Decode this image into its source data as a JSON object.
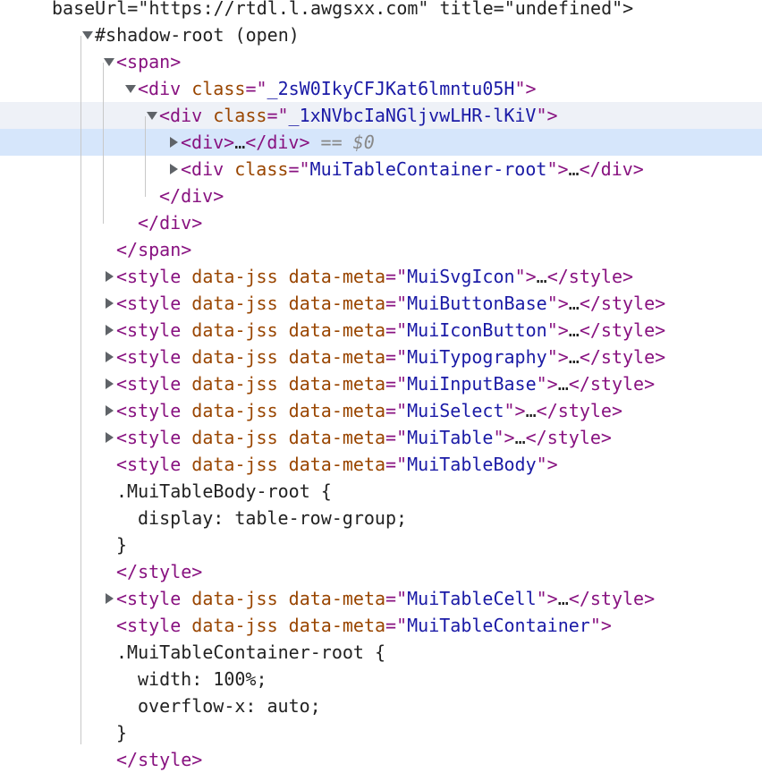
{
  "panel": "Elements",
  "lines": [
    {
      "id": "l0",
      "indent": 2,
      "toggle": "none",
      "state": "",
      "segments": [
        {
          "t": "baseUrl=\"https://rtdl.l.awgsxx.com\" title=\"undefined\">",
          "c": "pl"
        }
      ]
    },
    {
      "id": "l1",
      "indent": 4,
      "toggle": "open",
      "state": "",
      "segments": [
        {
          "t": "#shadow-root (open)",
          "c": "pl"
        }
      ]
    },
    {
      "id": "l2",
      "indent": 5,
      "toggle": "open",
      "state": "",
      "segments": [
        {
          "t": "<span>",
          "c": "tag"
        }
      ]
    },
    {
      "id": "l3",
      "indent": 6,
      "toggle": "open",
      "state": "",
      "segments": [
        {
          "t": "<div ",
          "c": "tag"
        },
        {
          "t": "class",
          "c": "an"
        },
        {
          "t": "=\"",
          "c": "tag"
        },
        {
          "t": "_2sW0IkyCFJKat6lmntu05H",
          "c": "av"
        },
        {
          "t": "\">",
          "c": "tag"
        }
      ]
    },
    {
      "id": "l4",
      "indent": 7,
      "toggle": "open",
      "state": "hover",
      "segments": [
        {
          "t": "<div ",
          "c": "tag"
        },
        {
          "t": "class",
          "c": "an"
        },
        {
          "t": "=\"",
          "c": "tag"
        },
        {
          "t": "_1xNVbcIaNGljvwLHR-lKiV",
          "c": "av"
        },
        {
          "t": "\">",
          "c": "tag"
        }
      ]
    },
    {
      "id": "l5",
      "indent": 8,
      "toggle": "closed",
      "state": "selected",
      "segments": [
        {
          "t": "<div>",
          "c": "tag"
        },
        {
          "t": "…",
          "c": "pl"
        },
        {
          "t": "</div>",
          "c": "tag"
        },
        {
          "t": " == $0",
          "c": "dim"
        }
      ]
    },
    {
      "id": "l6",
      "indent": 8,
      "toggle": "closed",
      "state": "",
      "segments": [
        {
          "t": "<div ",
          "c": "tag"
        },
        {
          "t": "class",
          "c": "an"
        },
        {
          "t": "=\"",
          "c": "tag"
        },
        {
          "t": "MuiTableContainer-root",
          "c": "av"
        },
        {
          "t": "\">",
          "c": "tag"
        },
        {
          "t": "…",
          "c": "pl"
        },
        {
          "t": "</div>",
          "c": "tag"
        }
      ]
    },
    {
      "id": "l7",
      "indent": 7,
      "toggle": "none",
      "state": "",
      "segments": [
        {
          "t": "</div>",
          "c": "tag"
        }
      ]
    },
    {
      "id": "l8",
      "indent": 6,
      "toggle": "none",
      "state": "",
      "segments": [
        {
          "t": "</div>",
          "c": "tag"
        }
      ]
    },
    {
      "id": "l9",
      "indent": 5,
      "toggle": "none",
      "state": "",
      "segments": [
        {
          "t": "</span>",
          "c": "tag"
        }
      ]
    },
    {
      "id": "l10",
      "indent": 5,
      "toggle": "closed",
      "state": "",
      "segments": [
        {
          "t": "<style ",
          "c": "tag"
        },
        {
          "t": "data-jss data-meta",
          "c": "an"
        },
        {
          "t": "=\"",
          "c": "tag"
        },
        {
          "t": "MuiSvgIcon",
          "c": "av"
        },
        {
          "t": "\">",
          "c": "tag"
        },
        {
          "t": "…",
          "c": "pl"
        },
        {
          "t": "</style>",
          "c": "tag"
        }
      ]
    },
    {
      "id": "l11",
      "indent": 5,
      "toggle": "closed",
      "state": "",
      "segments": [
        {
          "t": "<style ",
          "c": "tag"
        },
        {
          "t": "data-jss data-meta",
          "c": "an"
        },
        {
          "t": "=\"",
          "c": "tag"
        },
        {
          "t": "MuiButtonBase",
          "c": "av"
        },
        {
          "t": "\">",
          "c": "tag"
        },
        {
          "t": "…",
          "c": "pl"
        },
        {
          "t": "</style>",
          "c": "tag"
        }
      ]
    },
    {
      "id": "l12",
      "indent": 5,
      "toggle": "closed",
      "state": "",
      "segments": [
        {
          "t": "<style ",
          "c": "tag"
        },
        {
          "t": "data-jss data-meta",
          "c": "an"
        },
        {
          "t": "=\"",
          "c": "tag"
        },
        {
          "t": "MuiIconButton",
          "c": "av"
        },
        {
          "t": "\">",
          "c": "tag"
        },
        {
          "t": "…",
          "c": "pl"
        },
        {
          "t": "</style>",
          "c": "tag"
        }
      ]
    },
    {
      "id": "l13",
      "indent": 5,
      "toggle": "closed",
      "state": "",
      "segments": [
        {
          "t": "<style ",
          "c": "tag"
        },
        {
          "t": "data-jss data-meta",
          "c": "an"
        },
        {
          "t": "=\"",
          "c": "tag"
        },
        {
          "t": "MuiTypography",
          "c": "av"
        },
        {
          "t": "\">",
          "c": "tag"
        },
        {
          "t": "…",
          "c": "pl"
        },
        {
          "t": "</style>",
          "c": "tag"
        }
      ]
    },
    {
      "id": "l14",
      "indent": 5,
      "toggle": "closed",
      "state": "",
      "segments": [
        {
          "t": "<style ",
          "c": "tag"
        },
        {
          "t": "data-jss data-meta",
          "c": "an"
        },
        {
          "t": "=\"",
          "c": "tag"
        },
        {
          "t": "MuiInputBase",
          "c": "av"
        },
        {
          "t": "\">",
          "c": "tag"
        },
        {
          "t": "…",
          "c": "pl"
        },
        {
          "t": "</style>",
          "c": "tag"
        }
      ]
    },
    {
      "id": "l15",
      "indent": 5,
      "toggle": "closed",
      "state": "",
      "segments": [
        {
          "t": "<style ",
          "c": "tag"
        },
        {
          "t": "data-jss data-meta",
          "c": "an"
        },
        {
          "t": "=\"",
          "c": "tag"
        },
        {
          "t": "MuiSelect",
          "c": "av"
        },
        {
          "t": "\">",
          "c": "tag"
        },
        {
          "t": "…",
          "c": "pl"
        },
        {
          "t": "</style>",
          "c": "tag"
        }
      ]
    },
    {
      "id": "l16",
      "indent": 5,
      "toggle": "closed",
      "state": "",
      "segments": [
        {
          "t": "<style ",
          "c": "tag"
        },
        {
          "t": "data-jss data-meta",
          "c": "an"
        },
        {
          "t": "=\"",
          "c": "tag"
        },
        {
          "t": "MuiTable",
          "c": "av"
        },
        {
          "t": "\">",
          "c": "tag"
        },
        {
          "t": "…",
          "c": "pl"
        },
        {
          "t": "</style>",
          "c": "tag"
        }
      ]
    },
    {
      "id": "l17",
      "indent": 5,
      "toggle": "none",
      "state": "",
      "segments": [
        {
          "t": "<style ",
          "c": "tag"
        },
        {
          "t": "data-jss data-meta",
          "c": "an"
        },
        {
          "t": "=\"",
          "c": "tag"
        },
        {
          "t": "MuiTableBody",
          "c": "av"
        },
        {
          "t": "\">",
          "c": "tag"
        }
      ]
    },
    {
      "id": "l18",
      "indent": 5,
      "toggle": "none",
      "state": "",
      "segments": [
        {
          "t": ".MuiTableBody-root {",
          "c": "css"
        }
      ]
    },
    {
      "id": "l19",
      "indent": 6,
      "toggle": "none",
      "state": "",
      "segments": [
        {
          "t": "display: table-row-group;",
          "c": "css"
        }
      ]
    },
    {
      "id": "l20",
      "indent": 5,
      "toggle": "none",
      "state": "",
      "segments": [
        {
          "t": "}",
          "c": "css"
        }
      ]
    },
    {
      "id": "l21",
      "indent": 5,
      "toggle": "none",
      "state": "",
      "segments": [
        {
          "t": "</style>",
          "c": "tag"
        }
      ]
    },
    {
      "id": "l22",
      "indent": 5,
      "toggle": "closed",
      "state": "",
      "segments": [
        {
          "t": "<style ",
          "c": "tag"
        },
        {
          "t": "data-jss data-meta",
          "c": "an"
        },
        {
          "t": "=\"",
          "c": "tag"
        },
        {
          "t": "MuiTableCell",
          "c": "av"
        },
        {
          "t": "\">",
          "c": "tag"
        },
        {
          "t": "…",
          "c": "pl"
        },
        {
          "t": "</style>",
          "c": "tag"
        }
      ]
    },
    {
      "id": "l23",
      "indent": 5,
      "toggle": "none",
      "state": "",
      "segments": [
        {
          "t": "<style ",
          "c": "tag"
        },
        {
          "t": "data-jss data-meta",
          "c": "an"
        },
        {
          "t": "=\"",
          "c": "tag"
        },
        {
          "t": "MuiTableContainer",
          "c": "av"
        },
        {
          "t": "\">",
          "c": "tag"
        }
      ]
    },
    {
      "id": "l24",
      "indent": 5,
      "toggle": "none",
      "state": "",
      "segments": [
        {
          "t": ".MuiTableContainer-root {",
          "c": "css"
        }
      ]
    },
    {
      "id": "l25",
      "indent": 6,
      "toggle": "none",
      "state": "",
      "segments": [
        {
          "t": "width: 100%;",
          "c": "css"
        }
      ]
    },
    {
      "id": "l26",
      "indent": 6,
      "toggle": "none",
      "state": "",
      "segments": [
        {
          "t": "overflow-x: auto;",
          "c": "css"
        }
      ]
    },
    {
      "id": "l27",
      "indent": 5,
      "toggle": "none",
      "state": "",
      "segments": [
        {
          "t": "}",
          "c": "css"
        }
      ]
    },
    {
      "id": "l28",
      "indent": 5,
      "toggle": "none",
      "state": "",
      "segments": [
        {
          "t": "</style>",
          "c": "tag"
        }
      ]
    }
  ],
  "colors": {
    "tag": "#881280",
    "attr_name": "#994500",
    "attr_value": "#1a1aa6",
    "selected_bg": "#d6e6fb",
    "hover_bg": "#eef1f7"
  }
}
